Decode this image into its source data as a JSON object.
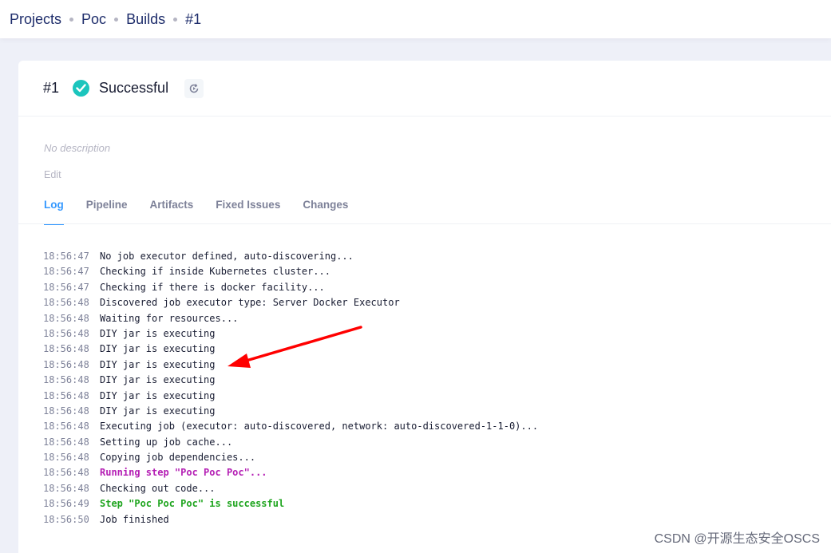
{
  "breadcrumb": {
    "items": [
      "Projects",
      "Poc",
      "Builds",
      "#1"
    ]
  },
  "build": {
    "number": "#1",
    "status": "Successful",
    "status_color": "#1bc5bd",
    "description": "No description",
    "edit_label": "Edit"
  },
  "tabs": [
    {
      "label": "Log",
      "active": true
    },
    {
      "label": "Pipeline",
      "active": false
    },
    {
      "label": "Artifacts",
      "active": false
    },
    {
      "label": "Fixed Issues",
      "active": false
    },
    {
      "label": "Changes",
      "active": false
    }
  ],
  "log": [
    {
      "time": "18:56:47",
      "msg": "No job executor defined, auto-discovering...",
      "style": ""
    },
    {
      "time": "18:56:47",
      "msg": "Checking if inside Kubernetes cluster...",
      "style": ""
    },
    {
      "time": "18:56:47",
      "msg": "Checking if there is docker facility...",
      "style": ""
    },
    {
      "time": "18:56:48",
      "msg": "Discovered job executor type: Server Docker Executor",
      "style": ""
    },
    {
      "time": "18:56:48",
      "msg": "Waiting for resources...",
      "style": ""
    },
    {
      "time": "18:56:48",
      "msg": "DIY jar is executing",
      "style": ""
    },
    {
      "time": "18:56:48",
      "msg": "DIY jar is executing",
      "style": ""
    },
    {
      "time": "18:56:48",
      "msg": "DIY jar is executing",
      "style": ""
    },
    {
      "time": "18:56:48",
      "msg": "DIY jar is executing",
      "style": ""
    },
    {
      "time": "18:56:48",
      "msg": "DIY jar is executing",
      "style": ""
    },
    {
      "time": "18:56:48",
      "msg": "DIY jar is executing",
      "style": ""
    },
    {
      "time": "18:56:48",
      "msg": "Executing job (executor: auto-discovered, network: auto-discovered-1-1-0)...",
      "style": ""
    },
    {
      "time": "18:56:48",
      "msg": "Setting up job cache...",
      "style": ""
    },
    {
      "time": "18:56:48",
      "msg": "Copying job dependencies...",
      "style": ""
    },
    {
      "time": "18:56:48",
      "msg": "Running step \"Poc Poc Poc\"...",
      "style": "purple"
    },
    {
      "time": "18:56:48",
      "msg": "Checking out code...",
      "style": ""
    },
    {
      "time": "18:56:49",
      "msg": "Step \"Poc Poc Poc\" is successful",
      "style": "green"
    },
    {
      "time": "18:56:50",
      "msg": "Job finished",
      "style": ""
    }
  ],
  "watermark": "CSDN @开源生态安全OSCS",
  "annotation_color": "#ff0000"
}
